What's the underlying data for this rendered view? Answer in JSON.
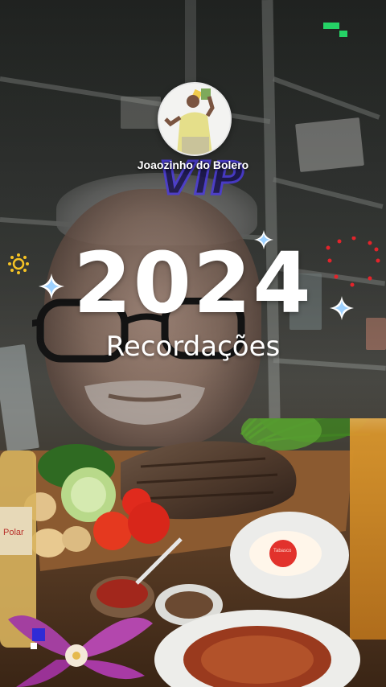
{
  "profile": {
    "username": "Joaozinho do Bolero",
    "stamp_text": "VIP"
  },
  "title": {
    "year": "2024",
    "subtitle": "Recordações"
  },
  "icons": {
    "brand": "pixel-logo-icon",
    "decor_left": "sun-icon",
    "decor_right": "heart-dots-icon",
    "sparkles": "sparkle-icon",
    "bottom_left": "cube-icon"
  },
  "colors": {
    "brand_green": "#25d366",
    "title_white": "#ffffff",
    "sparkle_blue": "#9ed1ff",
    "sun_yellow": "#f6c324",
    "heart_red": "#e3242b",
    "stamp_purple": "#4b3bdb"
  },
  "bottle_label": "Polar",
  "sauce_label": "Tabasco"
}
